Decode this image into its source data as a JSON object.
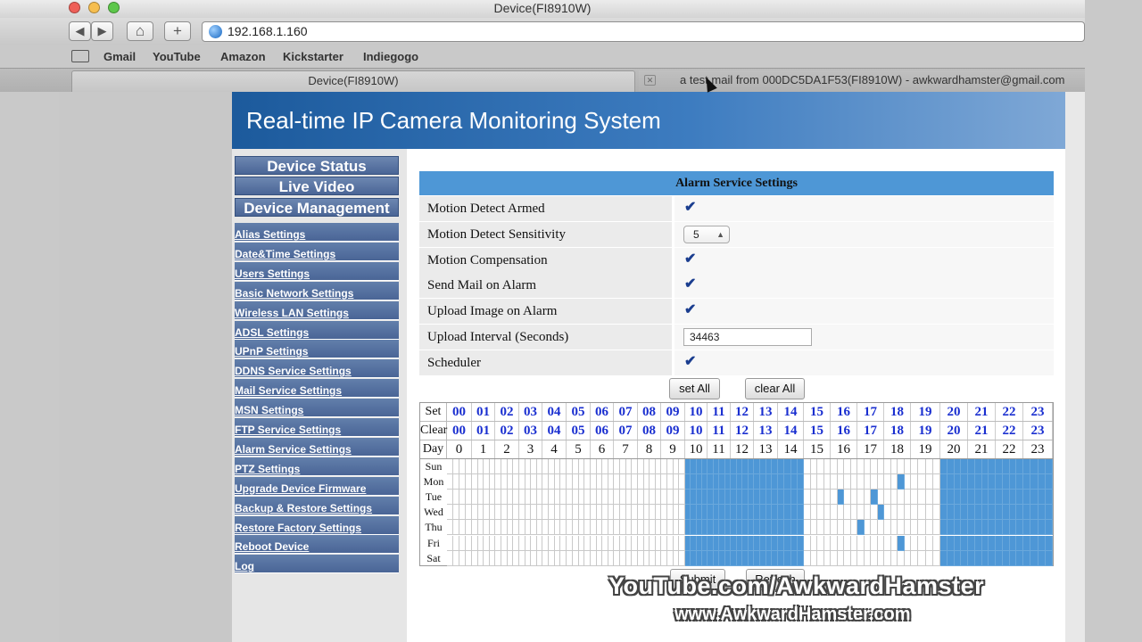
{
  "window": {
    "title": "Device(FI8910W)"
  },
  "toolbar": {
    "back": "◀",
    "forward": "▶",
    "home": "⌂",
    "add": "+",
    "url": "192.168.1.160"
  },
  "bookmarks": [
    {
      "label": "Gmail"
    },
    {
      "label": "YouTube"
    },
    {
      "label": "Amazon"
    },
    {
      "label": "Kickstarter"
    },
    {
      "label": "Indiegogo"
    }
  ],
  "tabs": [
    {
      "label": "Device(FI8910W)"
    },
    {
      "label": "a test mail from 000DC5DA1F53(FI8910W) - awkwardhamster@gmail.com"
    }
  ],
  "header": {
    "title": "Real-time IP Camera Monitoring System"
  },
  "top_nav": [
    {
      "label": "Device Status"
    },
    {
      "label": "Live Video"
    },
    {
      "label": "Device Management"
    }
  ],
  "side_nav": [
    {
      "label": "Alias Settings"
    },
    {
      "label": "Date&Time Settings"
    },
    {
      "label": "Users Settings"
    },
    {
      "label": "Basic Network Settings"
    },
    {
      "label": "Wireless LAN Settings"
    },
    {
      "label": "ADSL Settings"
    },
    {
      "label": "UPnP Settings"
    },
    {
      "label": "DDNS Service Settings"
    },
    {
      "label": "Mail Service Settings"
    },
    {
      "label": "MSN Settings"
    },
    {
      "label": "FTP Service Settings"
    },
    {
      "label": "Alarm Service Settings"
    },
    {
      "label": "PTZ Settings"
    },
    {
      "label": "Upgrade Device Firmware"
    },
    {
      "label": "Backup & Restore Settings"
    },
    {
      "label": "Restore Factory Settings"
    },
    {
      "label": "Reboot Device"
    },
    {
      "label": "Log"
    }
  ],
  "alarm": {
    "title": "Alarm Service Settings",
    "settings": [
      {
        "label": "Motion Detect Armed",
        "type": "checkbox",
        "checked": true
      },
      {
        "label": "Motion Detect Sensitivity",
        "type": "select",
        "value": "5"
      },
      {
        "label": "Motion Compensation",
        "type": "checkbox",
        "checked": true
      },
      {
        "label": "Send Mail on Alarm",
        "type": "checkbox",
        "checked": true
      },
      {
        "label": "Upload Image on Alarm",
        "type": "checkbox",
        "checked": true
      },
      {
        "label": "Upload Interval (Seconds)",
        "type": "text",
        "value": "34463"
      },
      {
        "label": "Scheduler",
        "type": "checkbox",
        "checked": true
      }
    ],
    "set_all": "set All",
    "clear_all": "clear All",
    "submit": "Submit",
    "refresh": "Refresh"
  },
  "schedule": {
    "row_labels": {
      "set": "Set",
      "clear": "Clear",
      "day": "Day"
    },
    "hours_link": [
      "00",
      "01",
      "02",
      "03",
      "04",
      "05",
      "06",
      "07",
      "08",
      "09",
      "10",
      "11",
      "12",
      "13",
      "14",
      "15",
      "16",
      "17",
      "18",
      "19",
      "20",
      "21",
      "22",
      "23"
    ],
    "hours_num": [
      "0",
      "1",
      "2",
      "3",
      "4",
      "5",
      "6",
      "7",
      "8",
      "9",
      "10",
      "11",
      "12",
      "13",
      "14",
      "15",
      "16",
      "17",
      "18",
      "19",
      "20",
      "21",
      "22",
      "23"
    ],
    "days": [
      "Sun",
      "Mon",
      "Tue",
      "Wed",
      "Thu",
      "Fri",
      "Sat"
    ],
    "active_hours_all_days": [
      10,
      11,
      12,
      13,
      14,
      20,
      21,
      22,
      23
    ],
    "extra_active": [
      {
        "day": 1,
        "hour": 18,
        "sub": 2
      },
      {
        "day": 2,
        "hour": 16,
        "sub": 1
      },
      {
        "day": 2,
        "hour": 17,
        "sub": 2
      },
      {
        "day": 3,
        "hour": 17,
        "sub": 3
      },
      {
        "day": 4,
        "hour": 17,
        "sub": 0
      },
      {
        "day": 5,
        "hour": 18,
        "sub": 2
      }
    ]
  },
  "watermark": {
    "line1": "YouTube.com/AwkwardHamster",
    "line2": "www.AwkwardHamster.com"
  }
}
